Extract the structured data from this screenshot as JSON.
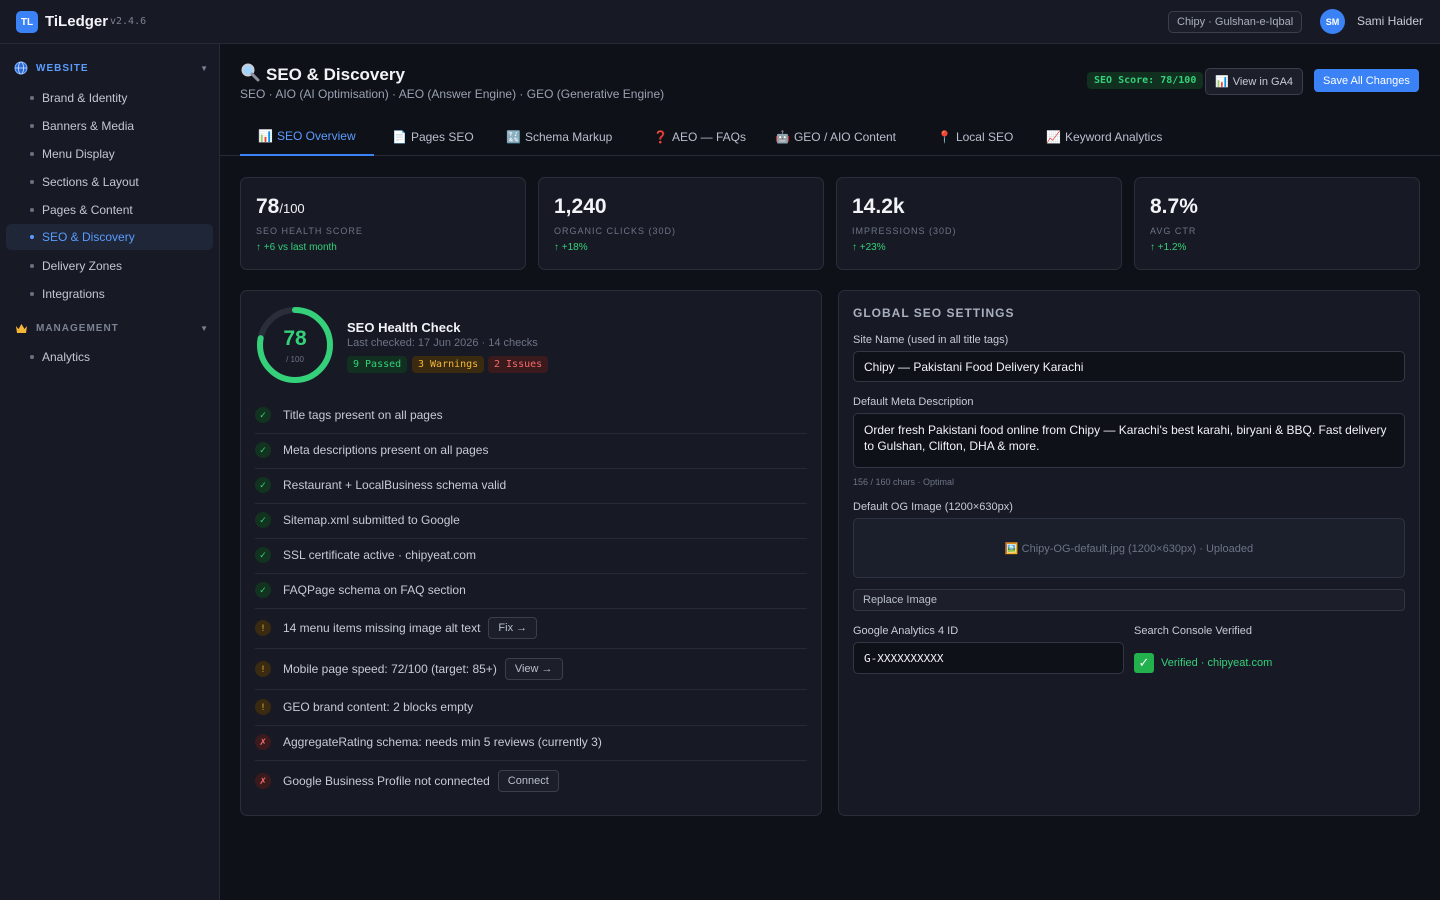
{
  "app": {
    "logo_text": "TL",
    "name": "TiLedger",
    "version": "v2.4.6"
  },
  "topbar": {
    "tenant": "Chipy · Gulshan-e-Iqbal",
    "avatar_initials": "SM",
    "user_name": "Sami Haider"
  },
  "sidebar": {
    "sections": [
      {
        "title": "WEBSITE",
        "icon": "globe-icon",
        "color": "#5b9cff"
      },
      {
        "title": "MANAGEMENT",
        "icon": "crown-icon",
        "color": "#7b8194"
      }
    ],
    "items": [
      {
        "label": "Brand & Identity"
      },
      {
        "label": "Banners & Media"
      },
      {
        "label": "Menu Display"
      },
      {
        "label": "Sections & Layout"
      },
      {
        "label": "Pages & Content"
      },
      {
        "label": "SEO & Discovery",
        "active": true
      },
      {
        "label": "Delivery Zones"
      },
      {
        "label": "Integrations"
      },
      {
        "label": "Analytics"
      }
    ]
  },
  "header": {
    "icon": "magnifier-icon",
    "title": "SEO & Discovery",
    "subtitle": "SEO · AIO (AI Optimisation) · AEO (Answer Engine) · GEO (Generative Engine)",
    "score_badge": "SEO Score: 78/100",
    "ga4_button": "View in GA4",
    "save_button": "Save All Changes"
  },
  "tabs": [
    {
      "icon": "📊",
      "label": "SEO Overview",
      "active": true
    },
    {
      "icon": "📄",
      "label": "Pages SEO"
    },
    {
      "icon": "🔣",
      "label": "Schema Markup"
    },
    {
      "icon": "❓",
      "label": "AEO — FAQs"
    },
    {
      "icon": "🤖",
      "label": "GEO / AIO Content"
    },
    {
      "icon": "📍",
      "label": "Local SEO"
    },
    {
      "icon": "📈",
      "label": "Keyword Analytics"
    }
  ],
  "stats": [
    {
      "value": "78",
      "suffix": "/100",
      "label": "SEO HEALTH SCORE",
      "delta": "↑ +6 vs last month"
    },
    {
      "value": "1,240",
      "suffix": "",
      "label": "ORGANIC CLICKS (30D)",
      "delta": "↑ +18%"
    },
    {
      "value": "14.2k",
      "suffix": "",
      "label": "IMPRESSIONS (30D)",
      "delta": "↑ +23%"
    },
    {
      "value": "8.7%",
      "suffix": "",
      "label": "AVG CTR",
      "delta": "↑ +1.2%"
    }
  ],
  "health": {
    "score": "78",
    "score_of": "/ 100",
    "score_fraction": 0.78,
    "title": "SEO Health Check",
    "subtitle": "Last checked: 17 Jun 2026 · 14 checks",
    "passed": "9 Passed",
    "warnings": "3 Warnings",
    "issues": "2 Issues",
    "checks": [
      {
        "status": "ok",
        "text": "Title tags present on all pages"
      },
      {
        "status": "ok",
        "text": "Meta descriptions present on all pages"
      },
      {
        "status": "ok",
        "text": "Restaurant + LocalBusiness schema valid"
      },
      {
        "status": "ok",
        "text": "Sitemap.xml submitted to Google"
      },
      {
        "status": "ok",
        "text": "SSL certificate active · chipyeat.com"
      },
      {
        "status": "ok",
        "text": "FAQPage schema on FAQ section"
      },
      {
        "status": "warn",
        "text": "14 menu items missing image alt text",
        "action": "Fix →"
      },
      {
        "status": "warn",
        "text": "Mobile page speed: 72/100 (target: 85+)",
        "action": "View →"
      },
      {
        "status": "warn",
        "text": "GEO brand content: 2 blocks empty"
      },
      {
        "status": "error",
        "text": "AggregateRating schema: needs min 5 reviews (currently 3)"
      },
      {
        "status": "error",
        "text": "Google Business Profile not connected",
        "action": "Connect"
      }
    ]
  },
  "settings": {
    "heading": "GLOBAL SEO SETTINGS",
    "site_name_label": "Site Name (used in all title tags)",
    "site_name_value": "Chipy — Pakistani Food Delivery Karachi",
    "meta_label": "Default Meta Description",
    "meta_value": "Order fresh Pakistani food online from Chipy — Karachi's best karahi, biryani & BBQ. Fast delivery to Gulshan, Clifton, DHA & more.",
    "meta_count": "156 / 160 chars · Optimal",
    "og_label": "Default OG Image (1200×630px)",
    "og_file": "🖼️ Chipy-OG-default.jpg (1200×630px) · Uploaded",
    "replace_button": "Replace Image",
    "ga4_label": "Google Analytics 4 ID",
    "ga4_value": "G-XXXXXXXXXX",
    "console_label": "Search Console Verified",
    "console_value": "Verified · chipyeat.com"
  }
}
